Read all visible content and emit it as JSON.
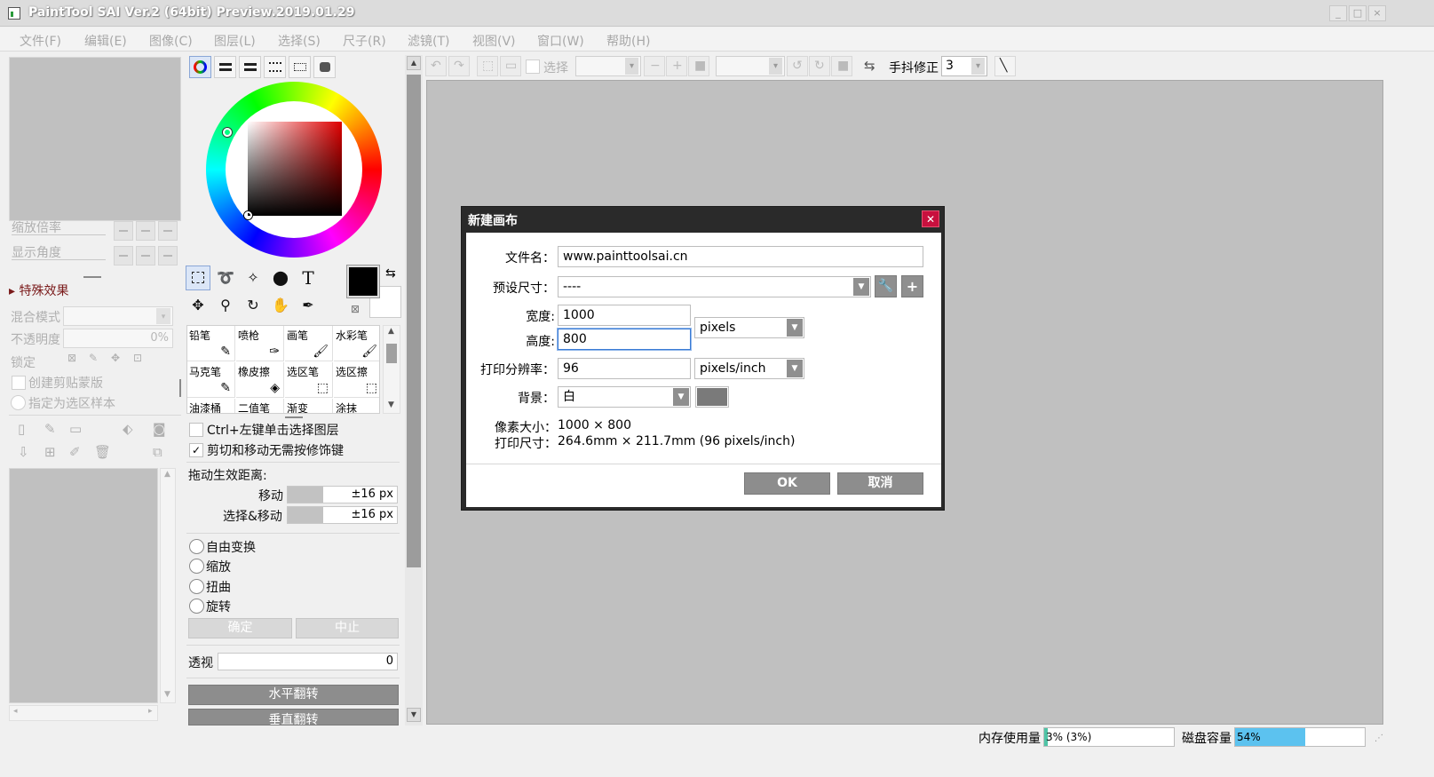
{
  "window": {
    "title": "PaintTool SAI Ver.2 (64bit) Preview.2019.01.29",
    "controls": [
      "_",
      "□",
      "×"
    ]
  },
  "menu": [
    "文件(F)",
    "编辑(E)",
    "图像(C)",
    "图层(L)",
    "选择(S)",
    "尺子(R)",
    "滤镜(T)",
    "视图(V)",
    "窗口(W)",
    "帮助(H)"
  ],
  "navigator": {
    "zoom_label": "缩放倍率",
    "angle_label": "显示角度"
  },
  "layer_panel": {
    "effects_label": "特殊效果",
    "blend_label": "混合模式",
    "opacity_label": "不透明度",
    "opacity_value": "0%",
    "lock_label": "锁定",
    "clipping_label": "创建剪贴蒙版",
    "selection_source_label": "指定为选区样本"
  },
  "tools": {
    "brushes": [
      "铅笔",
      "喷枪",
      "画笔",
      "水彩笔",
      "马克笔",
      "橡皮擦",
      "选区笔",
      "选区擦",
      "油漆桶",
      "二值笔",
      "渐变",
      "涂抹"
    ],
    "ctrl_click_label": "Ctrl+左键单击选择图层",
    "ctrl_click_checked": false,
    "cut_move_label": "剪切和移动无需按修饰键",
    "cut_move_checked": true,
    "drag_distance_label": "拖动生效距离:",
    "move_label": "移动",
    "move_value": "±16 px",
    "select_move_label": "选择&移动",
    "select_move_value": "±16 px",
    "transform_options": [
      "自由变换",
      "缩放",
      "扭曲",
      "旋转"
    ],
    "ok_label": "确定",
    "abort_label": "中止",
    "perspective_label": "透视",
    "perspective_value": "0",
    "flip_h_label": "水平翻转",
    "flip_v_label": "垂直翻转"
  },
  "toolbar": {
    "select_label": "选择",
    "stabilizer_label": "手抖修正",
    "stabilizer_value": "3"
  },
  "dialog": {
    "title": "新建画布",
    "filename_label": "文件名：",
    "filename_value": "www.painttoolsai.cn",
    "preset_label": "预设尺寸：",
    "preset_value": "----",
    "width_label": "宽度:",
    "width_value": "1000",
    "height_label": "高度:",
    "height_value": "800",
    "unit_value": "pixels",
    "resolution_label": "打印分辨率：",
    "resolution_value": "96",
    "resolution_unit": "pixels/inch",
    "background_label": "背景：",
    "background_value": "白",
    "pixel_size_label": "像素大小：",
    "pixel_size_value": "1000 × 800",
    "print_size_label": "打印尺寸：",
    "print_size_value": "264.6mm × 211.7mm (96 pixels/inch)",
    "ok_label": "OK",
    "cancel_label": "取消"
  },
  "status": {
    "memory_label": "内存使用量",
    "memory_value": "3% (3%)",
    "memory_fraction": 0.03,
    "disk_label": "磁盘容量",
    "disk_value": "54%",
    "disk_fraction": 0.54
  },
  "colors": {
    "accent_close": "#c8103e",
    "disk_bar": "#5cc2ef",
    "memory_bar": "#4fc4a6",
    "primary_color": "#000000",
    "secondary_color": "#ffffff"
  }
}
